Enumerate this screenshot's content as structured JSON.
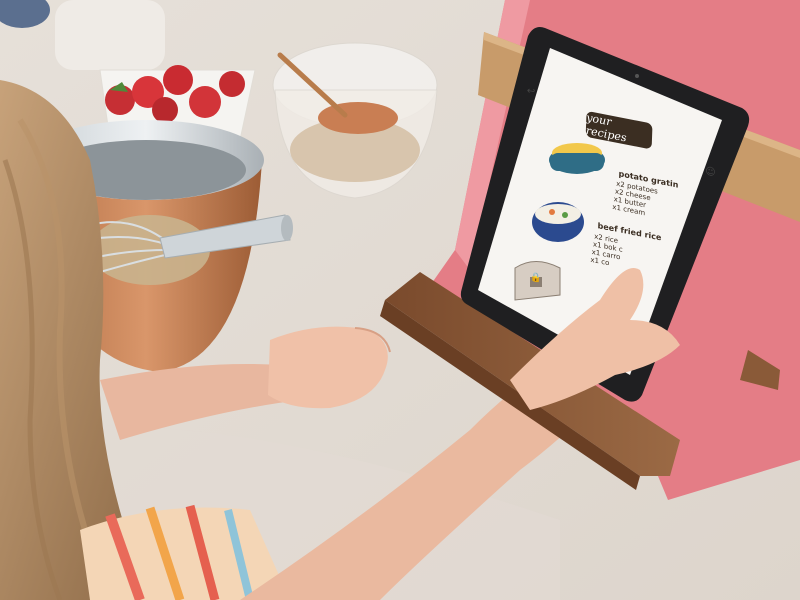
{
  "app": {
    "screen_title": "your recipes",
    "recipes": [
      {
        "name": "potato gratin",
        "ingredients": [
          "x2 potatoes",
          "x2 cheese",
          "x1 butter",
          "x1 cream"
        ]
      },
      {
        "name": "beef fried rice",
        "ingredients": [
          "x2 rice",
          "x1 bok c",
          "x1 carro",
          "x1 co"
        ]
      }
    ],
    "icons": {
      "top_left": "back-arrow-icon",
      "top_right": "user-icon",
      "locked_recipe": "lock-icon"
    }
  },
  "colors": {
    "stand_pink": "#e47d86",
    "wood": "#8a5a38",
    "tablet_bezel": "#1f1f21",
    "screen_bg": "#f7f5f2",
    "title_pill": "#3b2e22",
    "counter": "#e9e3dc"
  }
}
